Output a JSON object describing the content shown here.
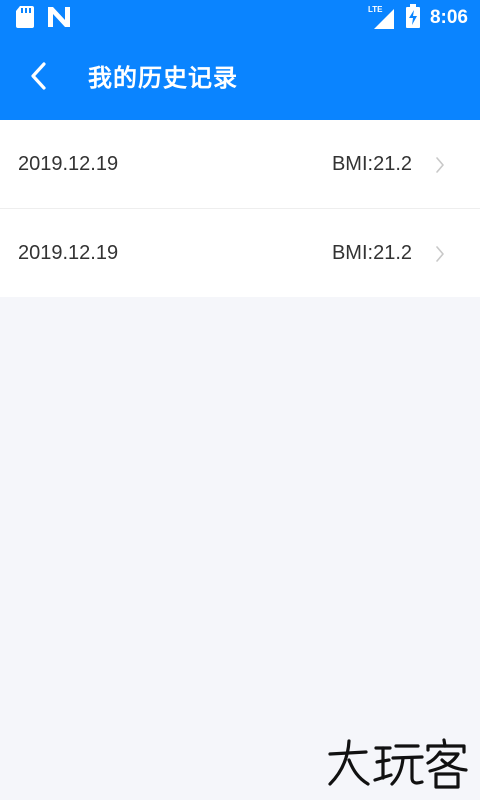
{
  "status_bar": {
    "time": "8:06",
    "network_label": "LTE",
    "icons": [
      "sd-card-icon",
      "n-notification-icon",
      "signal-icon",
      "battery-charging-icon"
    ]
  },
  "header": {
    "title": "我的历史记录",
    "back_icon": "chevron-left-icon"
  },
  "history": {
    "items": [
      {
        "date": "2019.12.19",
        "bmi": "BMI:21.2"
      },
      {
        "date": "2019.12.19",
        "bmi": "BMI:21.2"
      }
    ]
  },
  "watermark": {
    "text": "大玩客"
  },
  "colors": {
    "brand_blue": "#0a84ff",
    "background": "#f5f6fa",
    "text": "#333333",
    "chevron": "#c8c8c8"
  }
}
